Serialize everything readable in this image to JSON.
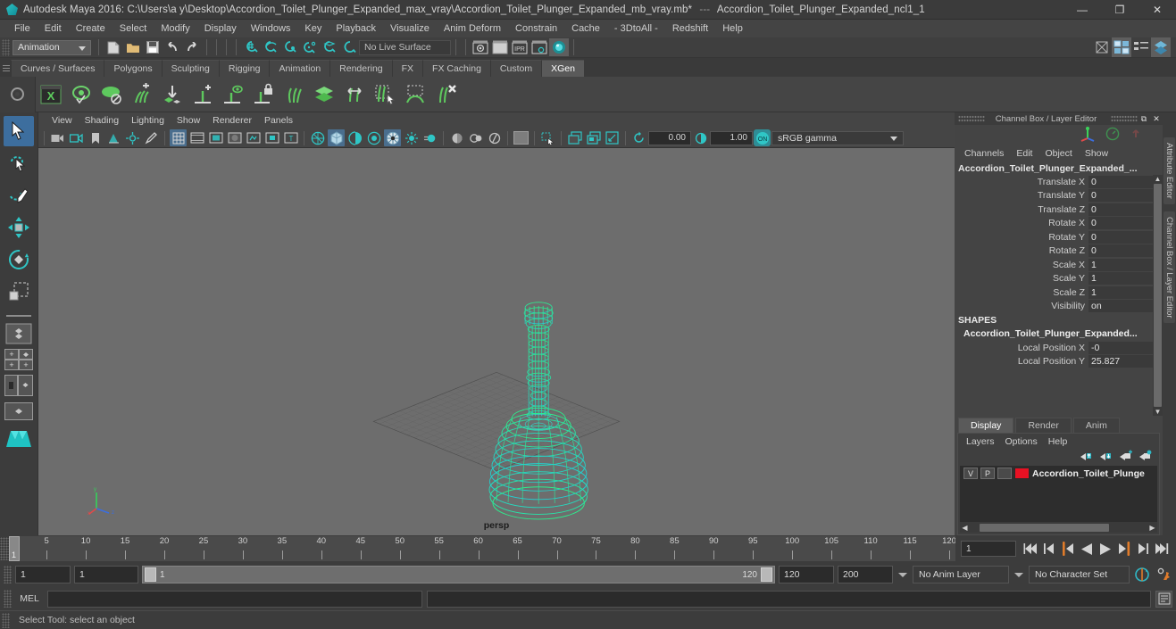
{
  "window": {
    "app_title": "Autodesk Maya 2016:",
    "file_path": "C:\\Users\\a y\\Desktop\\Accordion_Toilet_Plunger_Expanded_max_vray\\Accordion_Toilet_Plunger_Expanded_mb_vray.mb*",
    "separator": "---",
    "selected_node": "Accordion_Toilet_Plunger_Expanded_ncl1_1",
    "minimize": "—",
    "maximize": "❐",
    "close": "✕"
  },
  "menubar": {
    "items": [
      "File",
      "Edit",
      "Create",
      "Select",
      "Modify",
      "Display",
      "Windows",
      "Key",
      "Playback",
      "Visualize",
      "Anim Deform",
      "Constrain",
      "Cache",
      "- 3DtoAll -",
      "Redshift",
      "Help"
    ]
  },
  "statusline": {
    "mode": "Animation",
    "live_surface": "No Live Surface"
  },
  "shelf": {
    "tabs": [
      "Curves / Surfaces",
      "Polygons",
      "Sculpting",
      "Rigging",
      "Animation",
      "Rendering",
      "FX",
      "FX Caching",
      "Custom",
      "XGen"
    ],
    "active_tab": "XGen",
    "icons": [
      "xgen-editor-icon",
      "xgen-preview-icon",
      "xgen-no-preview-icon",
      "xgen-add-clumping-icon",
      "xgen-place-icon",
      "xgen-add-guide-icon",
      "xgen-guide-eye-icon",
      "xgen-lock-guide-icon",
      "xgen-groom-icon",
      "xgen-layers-icon",
      "xgen-move-guides-icon",
      "xgen-select-guides-icon",
      "xgen-region-icon",
      "xgen-delete-guides-icon"
    ]
  },
  "toolbox": {
    "items": [
      {
        "name": "select-tool",
        "selected": true
      },
      {
        "name": "lasso-select-tool",
        "selected": false
      },
      {
        "name": "paint-select-tool",
        "selected": false
      },
      {
        "name": "move-tool",
        "selected": false
      },
      {
        "name": "rotate-tool",
        "selected": false
      },
      {
        "name": "scale-tool",
        "selected": false
      }
    ],
    "layout_presets": [
      "single-perspective-layout",
      "four-view-layout",
      "persp-outliner-layout",
      "persp-graph-layout",
      "maya-logo-icon"
    ]
  },
  "viewport": {
    "menus": [
      "View",
      "Shading",
      "Lighting",
      "Show",
      "Renderer",
      "Panels"
    ],
    "camera_label": "persp",
    "exposure": "0.00",
    "gamma": "1.00",
    "color_management": "sRGB gamma",
    "color_mgmt_toggle": "ON",
    "axis_labels": {
      "x": "x",
      "y": "y",
      "z": "z"
    }
  },
  "channel_box": {
    "panel_title": "Channel Box / Layer Editor",
    "undock": "⧉",
    "close": "✕",
    "menus": [
      "Channels",
      "Edit",
      "Object",
      "Show"
    ],
    "object_name": "Accordion_Toilet_Plunger_Expanded_...",
    "transform_attrs": [
      {
        "label": "Translate X",
        "value": "0"
      },
      {
        "label": "Translate Y",
        "value": "0"
      },
      {
        "label": "Translate Z",
        "value": "0"
      },
      {
        "label": "Rotate X",
        "value": "0"
      },
      {
        "label": "Rotate Y",
        "value": "0"
      },
      {
        "label": "Rotate Z",
        "value": "0"
      },
      {
        "label": "Scale X",
        "value": "1"
      },
      {
        "label": "Scale Y",
        "value": "1"
      },
      {
        "label": "Scale Z",
        "value": "1"
      },
      {
        "label": "Visibility",
        "value": "on"
      }
    ],
    "shapes_header": "SHAPES",
    "shape_name": "Accordion_Toilet_Plunger_Expanded...",
    "shape_attrs": [
      {
        "label": "Local Position X",
        "value": "-0"
      },
      {
        "label": "Local Position Y",
        "value": "25.827"
      }
    ],
    "scroll_up": "▲",
    "scroll_down": "▼"
  },
  "layer_editor": {
    "tabs": [
      "Display",
      "Render",
      "Anim"
    ],
    "active_tab": "Display",
    "menus": [
      "Layers",
      "Options",
      "Help"
    ],
    "toolbar_icons": [
      "move-layer-up-icon",
      "move-layer-down-icon",
      "new-layer-icon",
      "new-layer-from-selected-icon"
    ],
    "layers": [
      {
        "visibility": "V",
        "playback": "P",
        "type": "",
        "color": "#e81123",
        "name": "Accordion_Toilet_Plunge"
      }
    ]
  },
  "side_tabs": [
    "Attribute Editor",
    "Channel Box / Layer Editor"
  ],
  "timeline": {
    "start": 1,
    "end": 120,
    "current_frame": "1",
    "tick_labels": [
      5,
      10,
      15,
      20,
      25,
      30,
      35,
      40,
      45,
      50,
      55,
      60,
      65,
      70,
      75,
      80,
      85,
      90,
      95,
      100,
      105,
      110,
      115,
      120
    ],
    "playhead_label": "1",
    "playback_buttons": [
      "go-to-start-icon",
      "step-back-keyframe-icon",
      "step-back-frame-icon",
      "play-backwards-icon",
      "play-forwards-icon",
      "step-forward-frame-icon",
      "step-forward-keyframe-icon",
      "go-to-end-icon"
    ]
  },
  "range_slider": {
    "anim_start": "1",
    "playback_start": "1",
    "bar_start_label": "1",
    "bar_end_label": "120",
    "playback_end": "120",
    "anim_end": "200",
    "anim_layer": "No Anim Layer",
    "character_set": "No Character Set",
    "auto_key_icon": "auto-keyframe-icon",
    "anim_prefs_icon": "animation-preferences-icon"
  },
  "command_line": {
    "label": "MEL",
    "input_value": "",
    "placeholder": "",
    "output_value": "",
    "script_editor_icon": "script-editor-icon"
  },
  "status_bar": {
    "help_text": "Select Tool: select an object"
  },
  "colors": {
    "accent_teal": "#2fc6c6",
    "mesh_green": "#2bf08e",
    "mesh_cyan": "#24d7d7",
    "selected_blue": "#3d6e9e",
    "layer_red": "#e81123",
    "viewport_bg": "#6d6d6d"
  }
}
